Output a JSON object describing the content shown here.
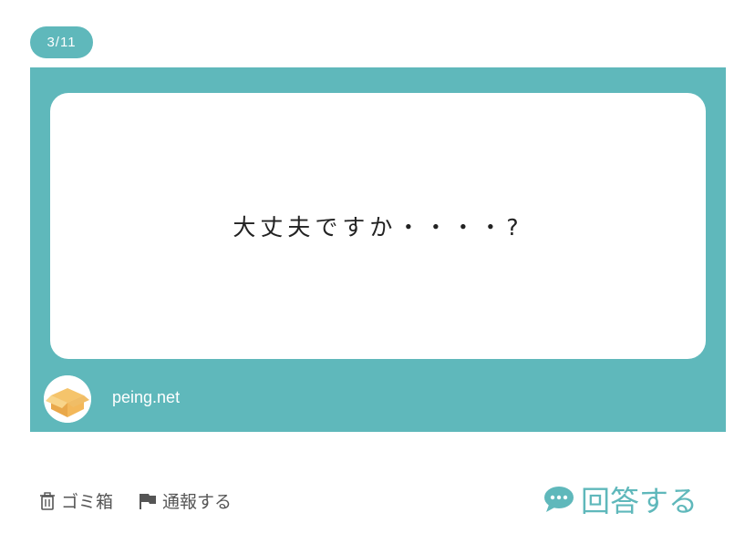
{
  "pager": {
    "label": "3/11"
  },
  "card": {
    "question": "大丈夫ですか・・・・?",
    "site": "peing.net",
    "accent_color": "#5fb8bb"
  },
  "actions": {
    "trash_label": "ゴミ箱",
    "report_label": "通報する",
    "answer_label": "回答する"
  },
  "icons": [
    "trash-icon",
    "flag-icon",
    "speech-bubble-icon",
    "cardboard-box-icon"
  ]
}
